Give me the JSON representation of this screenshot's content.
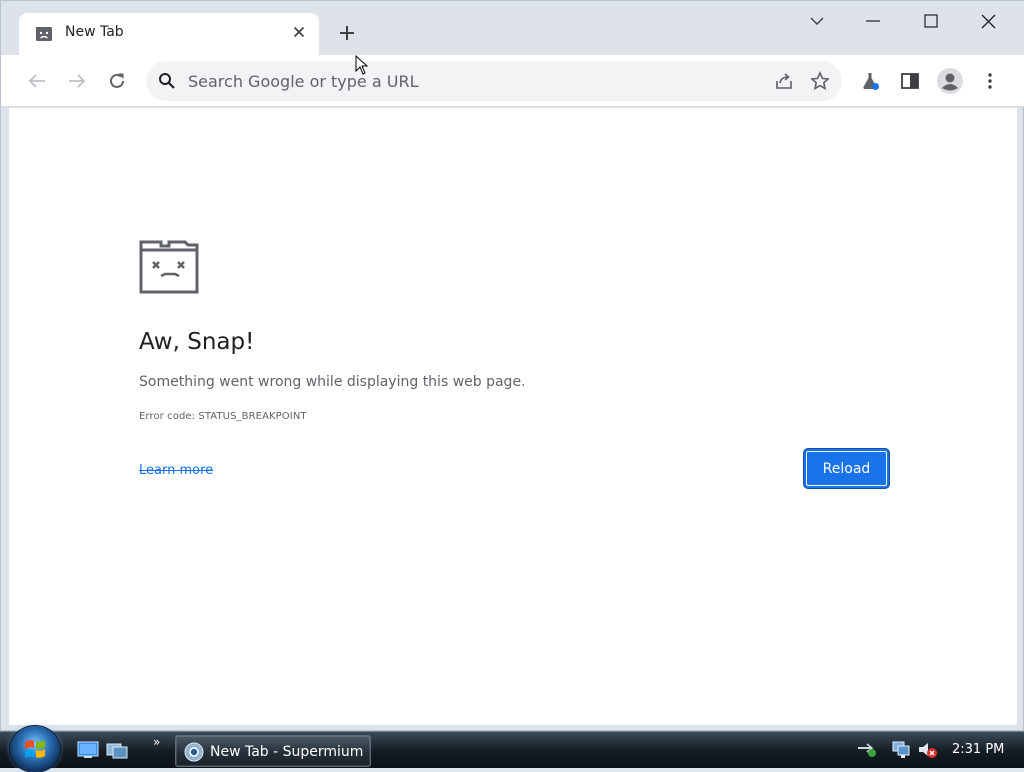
{
  "tab": {
    "title": "New Tab"
  },
  "omnibox": {
    "placeholder": "Search Google or type a URL"
  },
  "error": {
    "title": "Aw, Snap!",
    "message": "Something went wrong while displaying this web page.",
    "code": "Error code: STATUS_BREAKPOINT",
    "learn_more": "Learn more",
    "reload_label": "Reload"
  },
  "taskbar": {
    "task_label": "New Tab - Supermium",
    "clock": "2:31 PM"
  },
  "colors": {
    "accent": "#1a73e8",
    "tabstrip": "#dee3ea",
    "page_bg": "#ffffff"
  },
  "icons": [
    "sad-tab-icon",
    "close-icon",
    "plus-icon",
    "chevron-down-icon",
    "minimize-icon",
    "maximize-icon",
    "window-close-icon",
    "back-icon",
    "forward-icon",
    "reload-icon",
    "search-icon",
    "share-icon",
    "star-icon",
    "labs-flask-icon",
    "side-panel-icon",
    "profile-icon",
    "kebab-menu-icon",
    "sad-folder-icon",
    "windows-orb-icon",
    "show-desktop-icon",
    "switch-windows-icon",
    "chromium-icon",
    "network-icon",
    "network-error-icon",
    "volume-muted-icon"
  ]
}
